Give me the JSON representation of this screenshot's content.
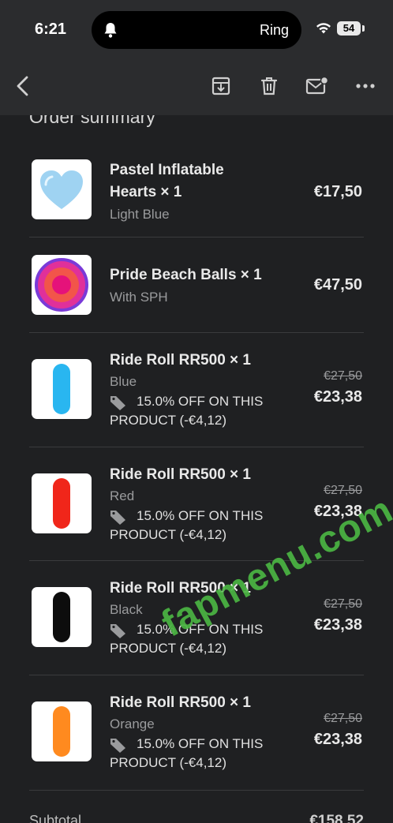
{
  "status_bar": {
    "time": "6:21",
    "island_label": "Ring",
    "battery": "54"
  },
  "toolbar": {
    "icons": [
      "back-icon",
      "archive-icon",
      "trash-icon",
      "mark-unread-icon",
      "more-icon"
    ]
  },
  "section_title": "Order summary",
  "items": [
    {
      "name": "Pastel Inflatable Hearts × 1",
      "variant": "Light Blue",
      "price": "€17,50",
      "thumb_color": "#9fd3f2",
      "thumb": "heart"
    },
    {
      "name": "Pride Beach Balls × 1",
      "variant": "With SPH",
      "price": "€47,50",
      "thumb_color": "#e0309a",
      "thumb": "ball"
    },
    {
      "name": "Ride Roll RR500 × 1",
      "variant": "Blue",
      "discount": "15.0% OFF ON THIS PRODUCT (-€4,12)",
      "old_price": "€27,50",
      "price": "€23,38",
      "thumb_color": "#29b6f0",
      "thumb": "roll"
    },
    {
      "name": "Ride Roll RR500 × 1",
      "variant": "Red",
      "discount": "15.0% OFF ON THIS PRODUCT (-€4,12)",
      "old_price": "€27,50",
      "price": "€23,38",
      "thumb_color": "#f0261a",
      "thumb": "roll"
    },
    {
      "name": "Ride Roll RR500 × 1",
      "variant": "Black",
      "discount": "15.0% OFF ON THIS PRODUCT (-€4,12)",
      "old_price": "€27,50",
      "price": "€23,38",
      "thumb_color": "#0d0d0d",
      "thumb": "roll"
    },
    {
      "name": "Ride Roll RR500 × 1",
      "variant": "Orange",
      "discount": "15.0% OFF ON THIS PRODUCT (-€4,12)",
      "old_price": "€27,50",
      "price": "€23,38",
      "thumb_color": "#ff8a1f",
      "thumb": "roll"
    }
  ],
  "subtotal": {
    "label": "Subtotal",
    "value": "€158,52"
  },
  "watermark": "fapmenu.com"
}
